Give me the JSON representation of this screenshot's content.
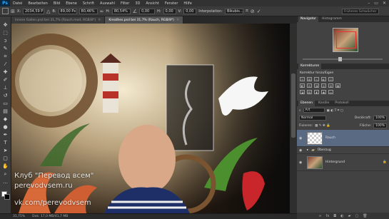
{
  "app": {
    "logo": "Ps"
  },
  "menu": [
    "Datei",
    "Bearbeiten",
    "Bild",
    "Ebene",
    "Schrift",
    "Auswahl",
    "Filter",
    "3D",
    "Ansicht",
    "Fenster",
    "Hilfe"
  ],
  "window_controls": [
    "–",
    "▭",
    "✕"
  ],
  "options": {
    "x": "2034,59 P",
    "w": "89,00 Px",
    "pct1": "80,46%",
    "pct2": "80,54%",
    "angle": "0,00",
    "h": "0,00",
    "v": "0,00",
    "interp_label": "Interpolation:",
    "interp_value": "Bikubis…",
    "workspace": "Früheres Schwächer"
  },
  "tabs": [
    {
      "label": "Innere Gallen.psd bei 31,7% (Rauch.mod, RGB/8*)",
      "close": "×"
    },
    {
      "label": "Kreathes.psd bei 31,7% (Rauch, RGB/8*)",
      "close": "×"
    }
  ],
  "status": {
    "zoom": "31,75%",
    "doc": "Dok: 17,0 MB/41,7 MB"
  },
  "panels": {
    "nav_tabs": [
      "Navigator",
      "Histogramm"
    ],
    "korr_tabs": [
      "Korrekturen"
    ],
    "korr_title": "Korrektur hinzufügen",
    "layer_tabs": [
      "Ebenen",
      "Kanäle",
      "Protokoll"
    ],
    "blend_mode": "Normal",
    "opacity_label": "Deckkraft:",
    "opacity": "100%",
    "lock_label": "Fixieren:",
    "fill_label": "Fläche:",
    "fill": "100%",
    "layers": [
      {
        "name": "Rauch",
        "selected": true
      },
      {
        "name": "Überzug",
        "selected": false
      },
      {
        "name": "Hintergrund",
        "selected": false
      }
    ]
  },
  "watermark": {
    "line1": "Клуб \"Перевод всем\"",
    "line2": "perevodvsem.ru",
    "line3": "vk.com/perevodvsem"
  }
}
